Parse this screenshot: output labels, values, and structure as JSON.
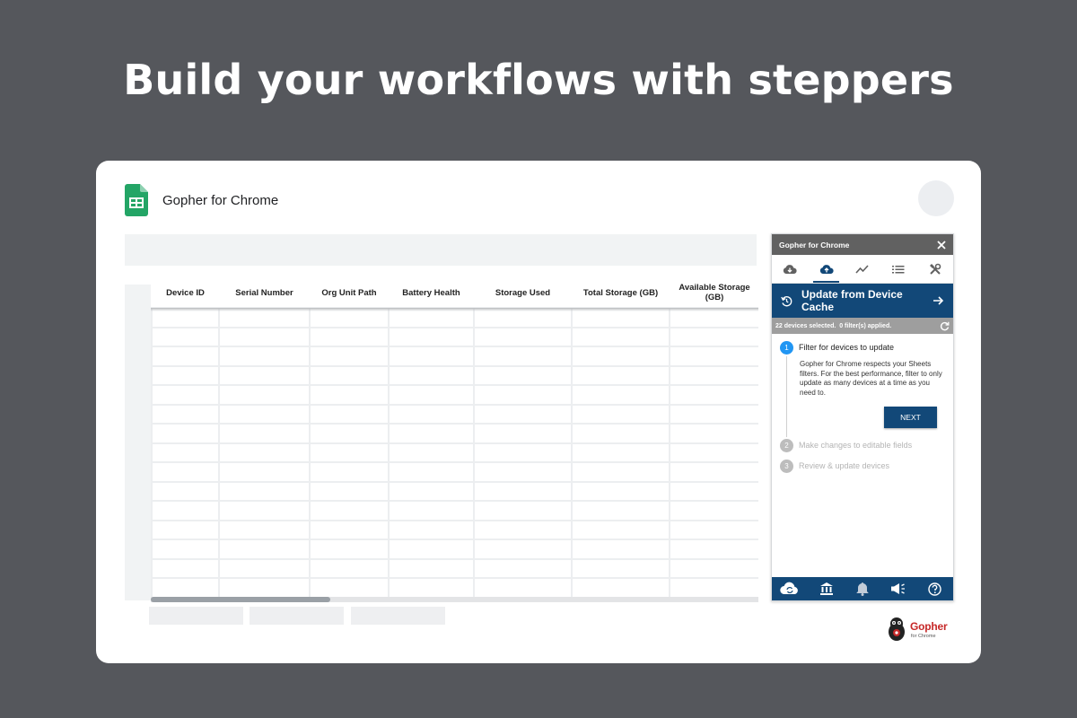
{
  "headline": "Build your workflows with steppers",
  "app": {
    "title": "Gopher for Chrome",
    "logo_icon": "google-sheets-icon"
  },
  "table": {
    "columns": [
      "Device ID",
      "Serial Number",
      "Org Unit Path",
      "Battery Health",
      "Storage Used",
      "Total Storage (GB)",
      "Available Storage (GB)"
    ],
    "row_count": 15
  },
  "sidebar": {
    "header_title": "Gopher for Chrome",
    "tabs": [
      {
        "icon": "cloud-download-icon"
      },
      {
        "icon": "cloud-upload-icon",
        "active": true
      },
      {
        "icon": "trending-icon"
      },
      {
        "icon": "list-icon"
      },
      {
        "icon": "tools-icon"
      }
    ],
    "panel_title": "Update from Device Cache",
    "status_text": "22 devices selected.  0 filter(s) applied.",
    "steps": [
      {
        "number": "1",
        "label": "Filter for devices to update",
        "active": true,
        "description": "Gopher for Chrome respects your Sheets filters. For the best performance, filter to only update as many devices at a time as you need to.",
        "button": "NEXT"
      },
      {
        "number": "2",
        "label": "Make changes to editable fields",
        "active": false
      },
      {
        "number": "3",
        "label": "Review & update devices",
        "active": false
      }
    ],
    "footer_icons": [
      "cloud-sync-icon",
      "bank-icon",
      "bell-icon",
      "megaphone-icon",
      "help-icon"
    ]
  },
  "brand": {
    "name": "Gopher",
    "sub": "for Chrome"
  },
  "colors": {
    "background": "#55575c",
    "primary": "#124878",
    "active_step": "#2196f3",
    "sheets_green": "#23a566"
  }
}
